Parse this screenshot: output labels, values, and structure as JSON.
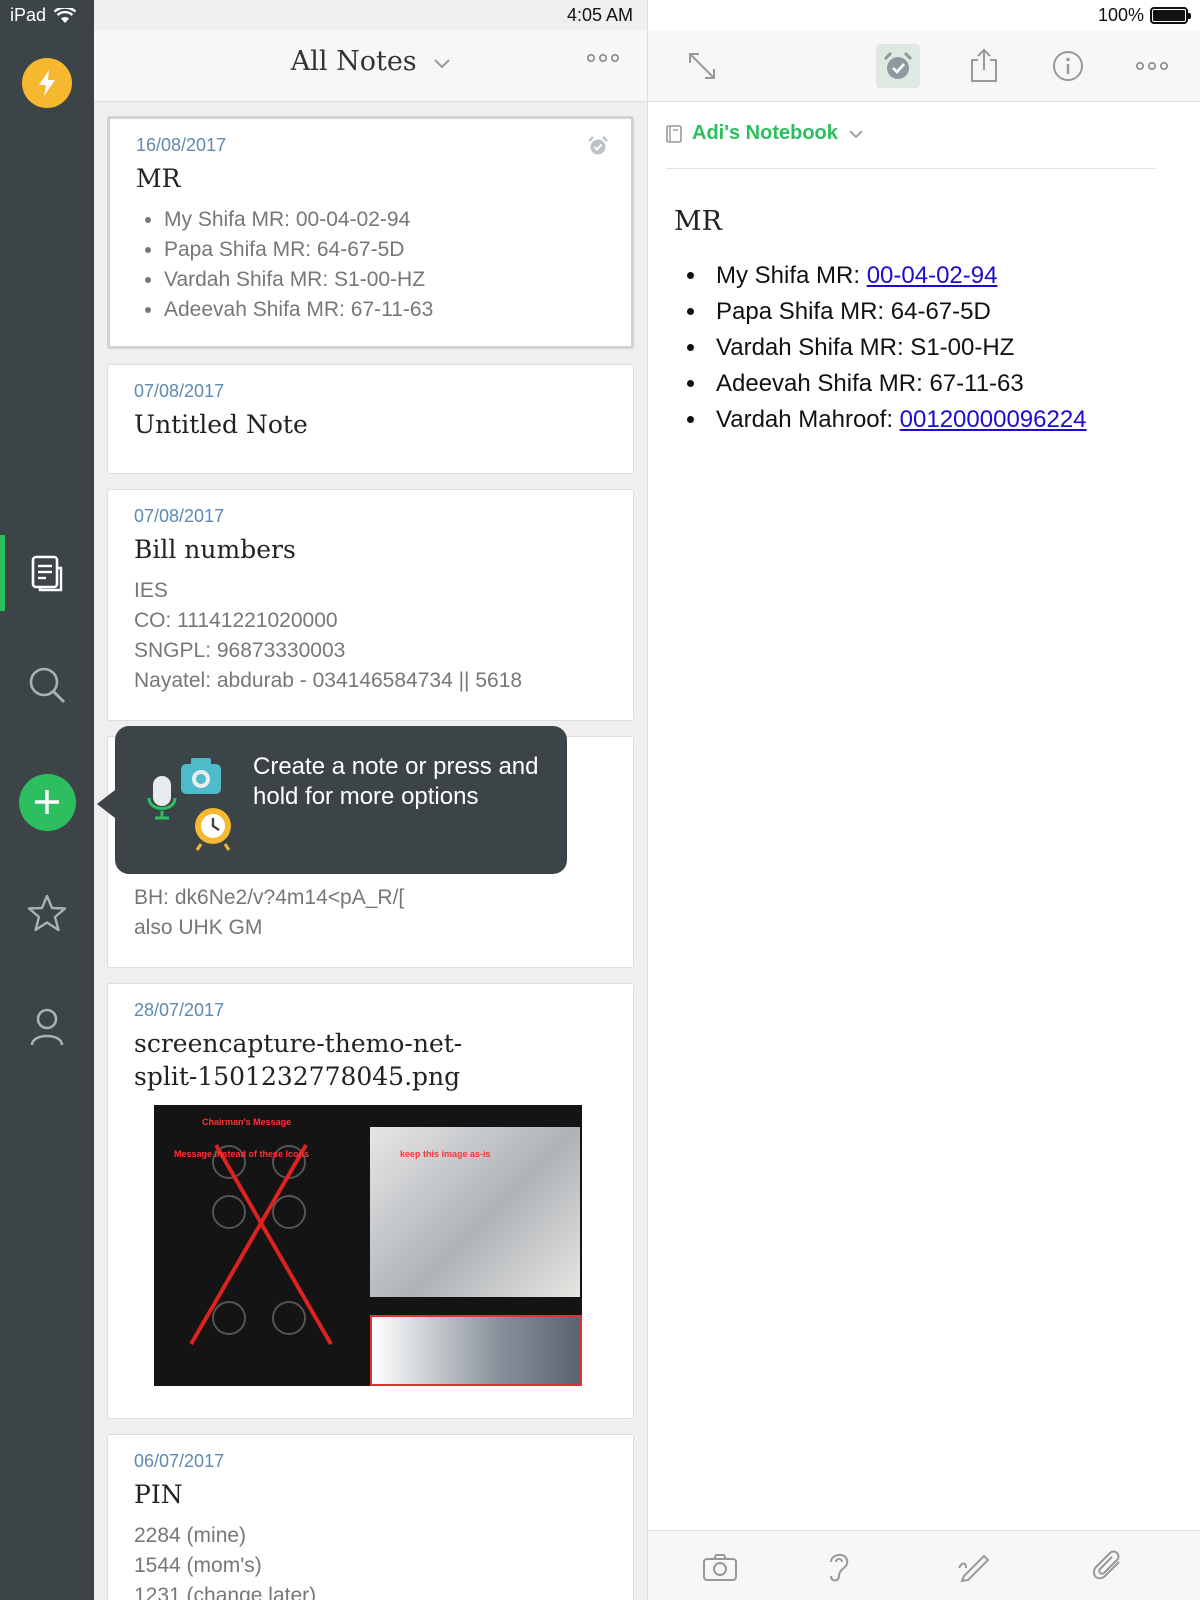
{
  "status_bar": {
    "device": "iPad",
    "time": "4:05 AM",
    "battery": "100%"
  },
  "sidebar": {
    "items": [
      "quick-note",
      "notes",
      "search",
      "new-note",
      "shortcuts",
      "account"
    ]
  },
  "list": {
    "title": "All Notes",
    "notes": [
      {
        "date": "16/08/2017",
        "title": "MR",
        "bullets": [
          "My Shifa MR: 00-04-02-94",
          "Papa Shifa MR: 64-67-5D",
          "Vardah Shifa MR: S1-00-HZ",
          "Adeevah Shifa MR: 67-11-63"
        ]
      },
      {
        "date": "07/08/2017",
        "title": "Untitled Note"
      },
      {
        "date": "07/08/2017",
        "title": "Bill numbers",
        "lines": [
          "IES",
          "CO: 11141221020000",
          "SNGPL: 96873330003",
          "Nayatel: abdurab - 034146584734 || 5618"
        ]
      },
      {
        "lines": [
          "BH: dk6Ne2/v?4m14<pA_R/[",
          "also UHK GM"
        ]
      },
      {
        "date": "28/07/2017",
        "title_line1": "screencapture-themo-net-",
        "title_line2": "split-1501232778045.png",
        "thumb_labels": {
          "chairman": "Chairman's Message",
          "message": "Message instead of these Icons",
          "keep": "keep this image as-is"
        }
      },
      {
        "date": "06/07/2017",
        "title": "PIN",
        "lines": [
          "2284 (mine)",
          "1544 (mom's)",
          "1231 (change later)"
        ]
      }
    ]
  },
  "tooltip": {
    "text": "Create a note or press and hold for more options"
  },
  "editor": {
    "notebook": "Adi's Notebook",
    "title": "MR",
    "items": [
      {
        "label": "My Shifa MR: ",
        "link": "00-04-02-94"
      },
      {
        "label": "Papa Shifa MR: 64-67-5D"
      },
      {
        "label": "Vardah Shifa MR: S1-00-HZ"
      },
      {
        "label": "Adeevah Shifa MR: 67-11-63"
      },
      {
        "label": "Vardah Mahroof: ",
        "link": "00120000096224"
      }
    ]
  },
  "colors": {
    "sidebar": "#3c4448",
    "accent_green": "#2dbe60",
    "bolt_yellow": "#f5b82e",
    "date_blue": "#5c8ab2",
    "link_blue": "#1a0dcd"
  }
}
